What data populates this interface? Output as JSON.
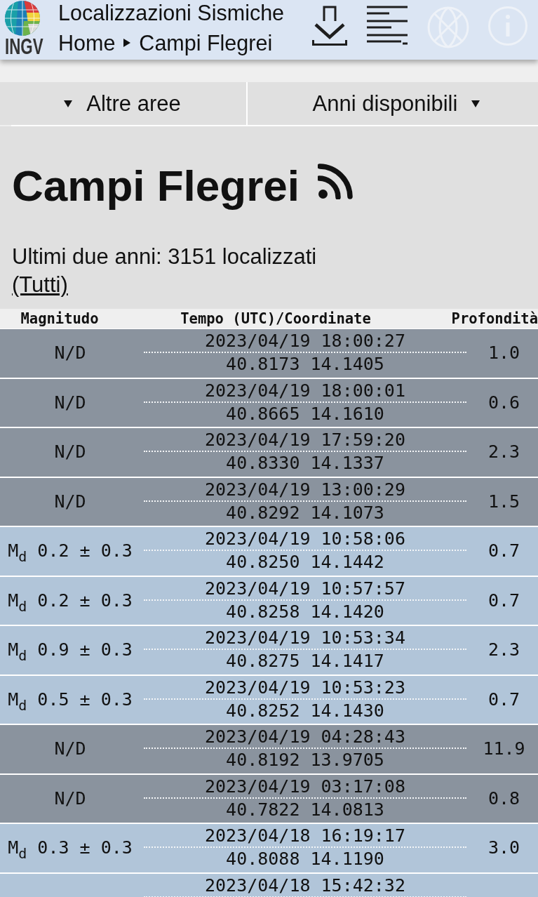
{
  "header": {
    "logo": {
      "text": "INGV"
    },
    "title": "Localizzazioni Sismiche",
    "breadcrumb": [
      "Home",
      "Campi Flegrei"
    ],
    "tools": [
      {
        "kind": "download",
        "disabled": false
      },
      {
        "kind": "list",
        "disabled": false
      },
      {
        "kind": "map",
        "disabled": true
      },
      {
        "kind": "info",
        "disabled": true
      }
    ]
  },
  "nav": {
    "dropdowns": [
      {
        "label": "Altre aree",
        "kind": "leading"
      },
      {
        "label": "Anni disponibili",
        "kind": "trailing"
      }
    ]
  },
  "page": {
    "title": "Campi Flegrei",
    "summary": "Ultimi due anni: 3151 localizzati",
    "all_link": "(Tutti)"
  },
  "table": {
    "columns": [
      "Magnitudo",
      "Tempo (UTC)/Coordinate",
      "Profondità"
    ],
    "rows": [
      {
        "color": "#8a939e",
        "magnitude": "N/D",
        "time": "2023/04/19 18:00:27",
        "coordinates": "40.8173 14.1405",
        "depth": "1.0"
      },
      {
        "color": "#8a939e",
        "magnitude": "N/D",
        "time": "2023/04/19 18:00:01",
        "coordinates": "40.8665 14.1610",
        "depth": "0.6"
      },
      {
        "color": "#8a939e",
        "magnitude": "N/D",
        "time": "2023/04/19 17:59:20",
        "coordinates": "40.8330 14.1337",
        "depth": "2.3"
      },
      {
        "color": "#8a939e",
        "magnitude": "N/D",
        "time": "2023/04/19 13:00:29",
        "coordinates": "40.8292 14.1073",
        "depth": "1.5"
      },
      {
        "color": "#b1c5d9",
        "magnitude": "M$_{d}$ 0.2 ± 0.3",
        "time": "2023/04/19 10:58:06",
        "coordinates": "40.8250 14.1442",
        "depth": "0.7"
      },
      {
        "color": "#b1c5d9",
        "magnitude": "M$_{d}$ 0.2 ± 0.3",
        "time": "2023/04/19 10:57:57",
        "coordinates": "40.8258 14.1420",
        "depth": "0.7"
      },
      {
        "color": "#b1c5d9",
        "magnitude": "M$_{d}$ 0.9 ± 0.3",
        "time": "2023/04/19 10:53:34",
        "coordinates": "40.8275 14.1417",
        "depth": "2.3"
      },
      {
        "color": "#b1c5d9",
        "magnitude": "M$_{d}$ 0.5 ± 0.3",
        "time": "2023/04/19 10:53:23",
        "coordinates": "40.8252 14.1430",
        "depth": "0.7"
      },
      {
        "color": "#8a939e",
        "magnitude": "N/D",
        "time": "2023/04/19 04:28:43",
        "coordinates": "40.8192 13.9705",
        "depth": "11.9"
      },
      {
        "color": "#8a939e",
        "magnitude": "N/D",
        "time": "2023/04/19 03:17:08",
        "coordinates": "40.7822 14.0813",
        "depth": "0.8"
      },
      {
        "color": "#b1c5d9",
        "magnitude": "M$_{d}$ 0.3 ± 0.3",
        "time": "2023/04/18 16:19:17",
        "coordinates": "40.8088 14.1190",
        "depth": "3.0"
      },
      {
        "color": "#b1c5d9",
        "time": "2023/04/18 15:42:32"
      }
    ]
  }
}
